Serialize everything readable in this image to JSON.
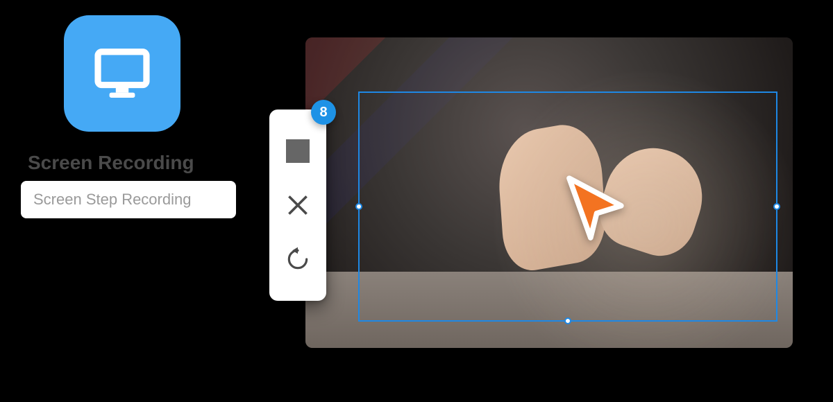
{
  "app": {
    "icon_name": "monitor-icon",
    "accent": "#45a9f5"
  },
  "labels": {
    "title": "Screen Recording",
    "subtitle": "Screen Step Recording"
  },
  "toolbar": {
    "badge_count": "8",
    "stop_label": "Stop",
    "cancel_label": "Cancel",
    "restart_label": "Restart"
  },
  "cursor": {
    "color": "#f37321"
  },
  "selection": {
    "border_color": "#1e88e5"
  }
}
